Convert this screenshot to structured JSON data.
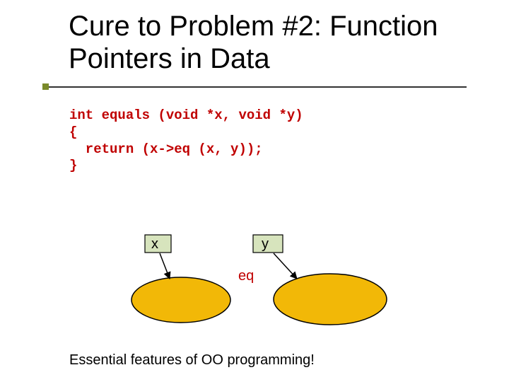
{
  "slide": {
    "title": "Cure to Problem #2: Function Pointers in Data",
    "code": "int equals (void *x, void *y)\n{\n  return (x->eq (x, y));\n}",
    "labels": {
      "x": "x",
      "y": "y",
      "eq": "eq"
    },
    "caption": "Essential features of OO programming!"
  },
  "colors": {
    "code": "#c00000",
    "ellipse_fill": "#f2b807",
    "box_fill": "#d7e4bd",
    "rule_accent": "#7a8a2a"
  }
}
